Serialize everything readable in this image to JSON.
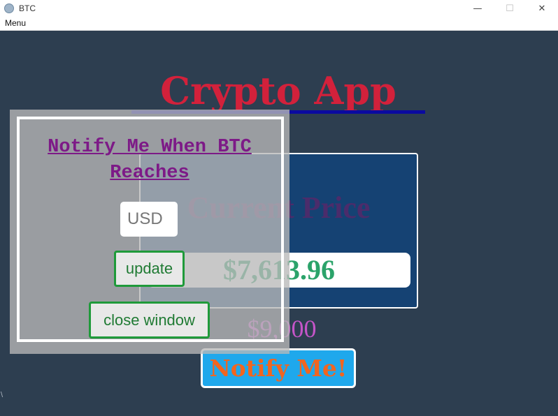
{
  "window": {
    "title": "BTC",
    "minimize_glyph": "—",
    "maximize_glyph": "☐",
    "close_glyph": "✕",
    "icon": "app-logo-icon"
  },
  "menubar": {
    "menu_label": "Menu"
  },
  "app": {
    "title": "Crypto App",
    "price_card": {
      "heading": "Current Price",
      "value": "$7,613.96"
    },
    "target_price": "$9,000",
    "notify_label": "Notify Me!"
  },
  "modal": {
    "title": "Notify Me When BTC Reaches",
    "input_placeholder": "USD",
    "input_value": "",
    "update_label": "update",
    "close_label": "close window"
  },
  "stray_text": "\\",
  "colors": {
    "background": "#2d3e50",
    "title_red": "#d2213b",
    "card_blue": "#154273",
    "price_green": "#2ba36a",
    "notify_blue": "#1fa8ec",
    "notify_orange": "#f2651f",
    "modal_title_purple": "#7d1a87",
    "button_green": "#1f9a3a"
  }
}
